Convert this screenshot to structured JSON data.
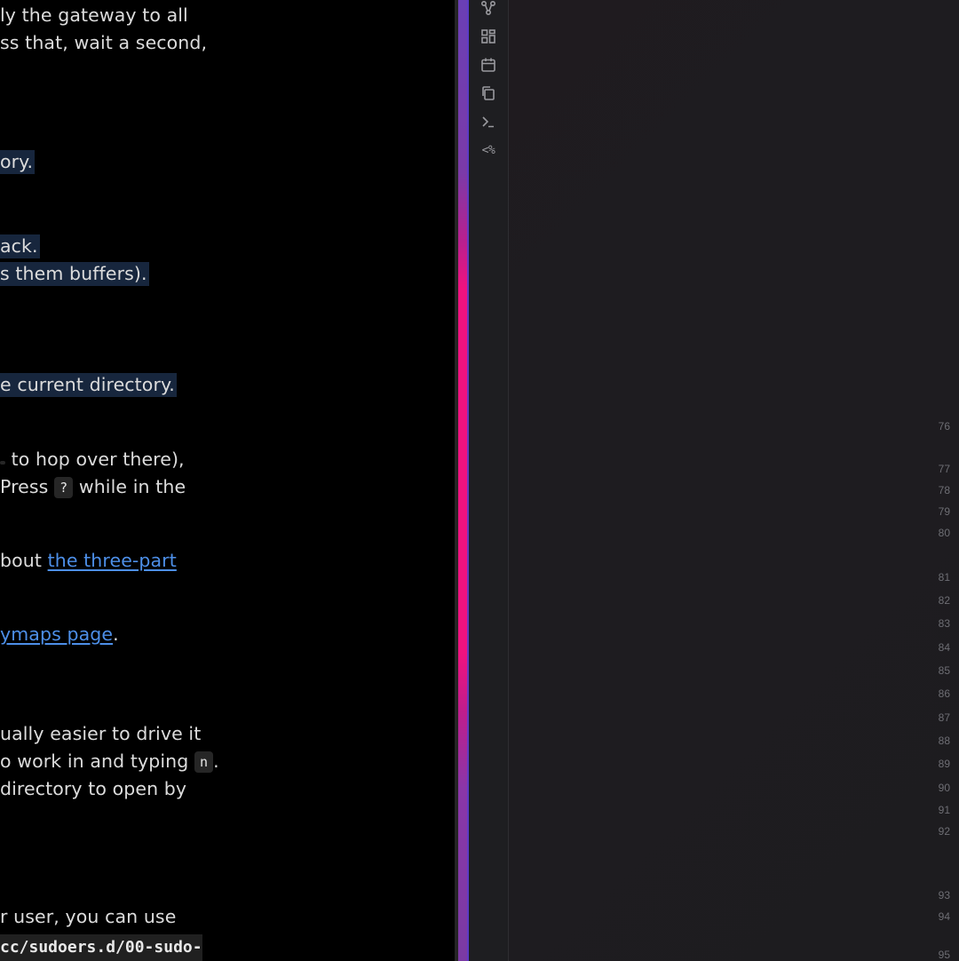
{
  "preview": {
    "lines": [
      {
        "id": "l1",
        "parts": [
          {
            "t": "text",
            "v": "ly the gateway to all"
          }
        ]
      },
      {
        "id": "l2",
        "parts": [
          {
            "t": "text",
            "v": "ss that, wait a second,"
          }
        ]
      },
      {
        "id": "l3",
        "parts": [
          {
            "t": "hl",
            "v": "ory."
          }
        ]
      },
      {
        "id": "l4",
        "parts": [
          {
            "t": "hl",
            "v": "ack."
          }
        ]
      },
      {
        "id": "l5",
        "parts": [
          {
            "t": "hl",
            "v": "s them buffers)."
          }
        ]
      },
      {
        "id": "l6",
        "parts": [
          {
            "t": "hl",
            "v": "e current directory."
          }
        ]
      },
      {
        "id": "l7",
        "parts": [
          {
            "t": "kbdcut",
            "v": ""
          },
          {
            "t": "text",
            "v": " to hop over there),"
          }
        ]
      },
      {
        "id": "l8",
        "parts": [
          {
            "t": "text",
            "v": "Press "
          },
          {
            "t": "kbd",
            "v": "?"
          },
          {
            "t": "text",
            "v": " while in the"
          }
        ]
      },
      {
        "id": "l9",
        "parts": [
          {
            "t": "text",
            "v": "bout "
          },
          {
            "t": "link",
            "v": "the three-part"
          }
        ]
      },
      {
        "id": "l10",
        "parts": [
          {
            "t": "link",
            "v": "ymaps page"
          },
          {
            "t": "text",
            "v": "."
          }
        ]
      },
      {
        "id": "l11",
        "parts": [
          {
            "t": "text",
            "v": "ually easier to drive it"
          }
        ]
      },
      {
        "id": "l12",
        "parts": [
          {
            "t": "text",
            "v": "o work in and typing "
          },
          {
            "t": "kbd",
            "v": "n"
          },
          {
            "t": "text",
            "v": "."
          }
        ]
      },
      {
        "id": "l13",
        "parts": [
          {
            "t": "text",
            "v": " directory to open by"
          }
        ]
      },
      {
        "id": "l14",
        "parts": [
          {
            "t": "text",
            "v": "r user, you can use"
          }
        ]
      }
    ],
    "code_line": "cc/sudoers.d/00-sudo-"
  },
  "ribbon": {
    "icons": [
      "graph-icon",
      "grid-icon",
      "calendar-icon",
      "copy-icon",
      "terminal-icon",
      "template-icon"
    ],
    "template_text": "<%"
  },
  "editor": {
    "line_numbers": [
      "76",
      "77",
      "78",
      "79",
      "80",
      "81",
      "82",
      "83",
      "84",
      "85",
      "86",
      "87",
      "88",
      "89",
      "90",
      "91",
      "92",
      "93",
      "94",
      "95"
    ]
  },
  "colors": {
    "accent_pink": "#f0127f",
    "accent_purple": "#6a3fb5",
    "link": "#4d8fe8",
    "highlight": "#17263d"
  }
}
